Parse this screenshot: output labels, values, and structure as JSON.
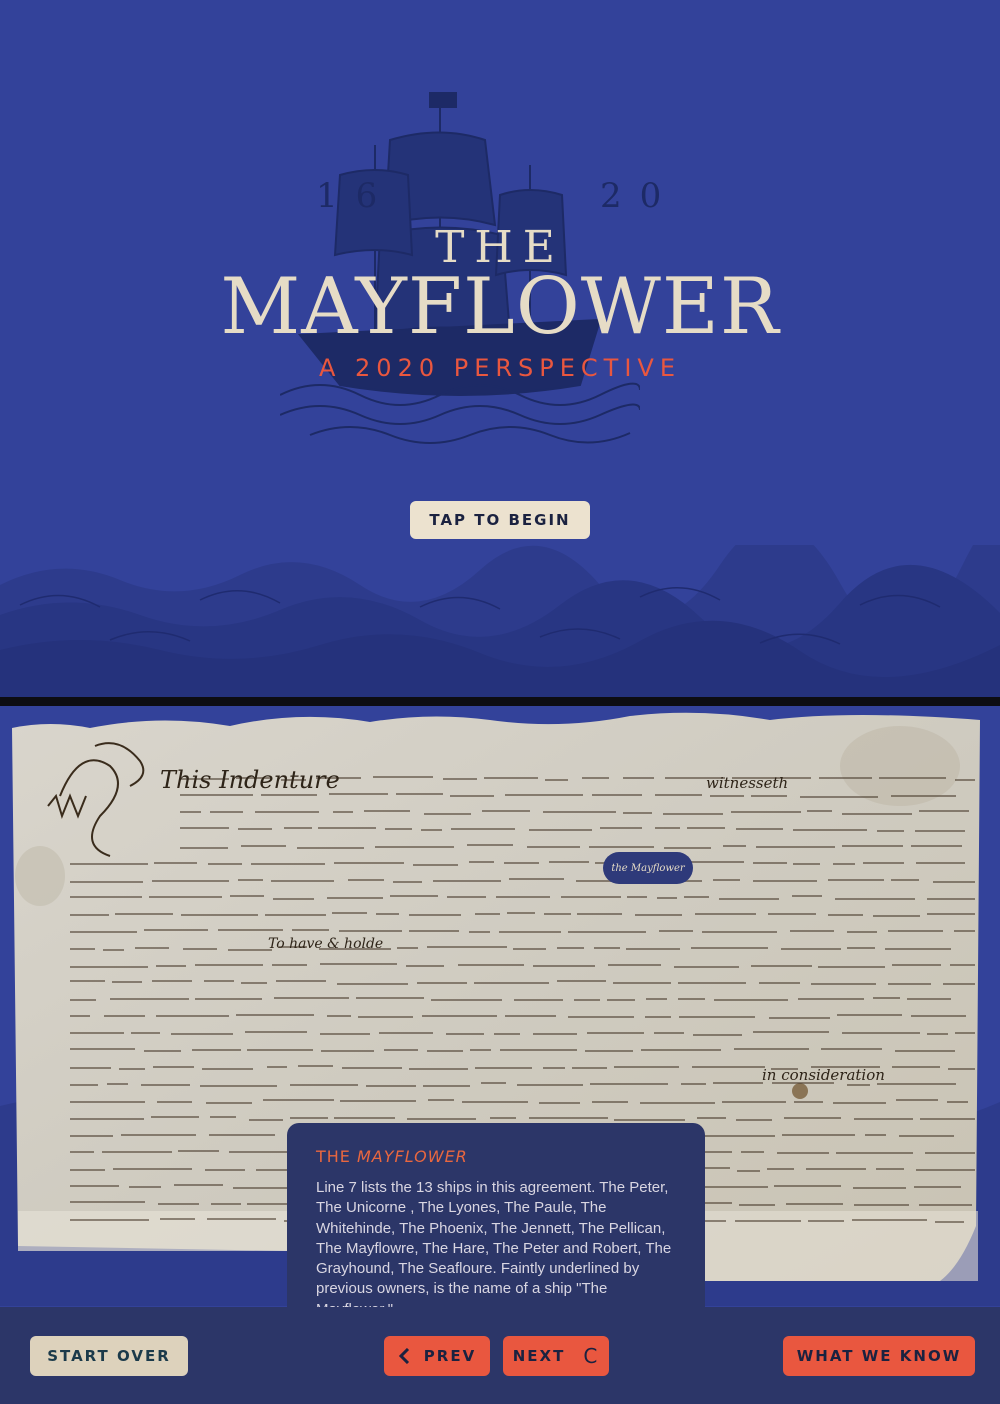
{
  "splash": {
    "year_left": "16",
    "year_right": "20",
    "title_the": "THE",
    "title_main": "MAYFLOWER",
    "subtitle": "A 2020 PERSPECTIVE",
    "begin_label": "TAP TO BEGIN",
    "colors": {
      "background": "#33429a",
      "cream": "#e6dcc6",
      "accent": "#e9573f"
    }
  },
  "document": {
    "opening_word": "This Indenture",
    "margin_word": "witnesseth",
    "mid_phrase": "To have & holde",
    "lower_phrase": "in consideration",
    "ship_chip_label": "the Mayflower"
  },
  "info": {
    "title_prefix": "THE ",
    "title_ship": "MAYFLOWER",
    "body": "Line 7 lists the 13 ships in this agreement. The Peter, The Unicorne , The Lyones, The Paule, The Whitehinde, The Phoenix, The Jennett, The Pellican, The Mayflowre, The Hare, The Peter and Robert, The Grayhound, The Seafloure. Faintly underlined by previous owners, is the name of a ship \"The Mayflower.\""
  },
  "nav": {
    "start_over": "START OVER",
    "prev": "PREV",
    "next": "NEXT",
    "what_we_know": "WHAT WE KNOW",
    "prev_icon": "chevron-left-icon",
    "loading_icon": "loading-spinner-icon"
  }
}
